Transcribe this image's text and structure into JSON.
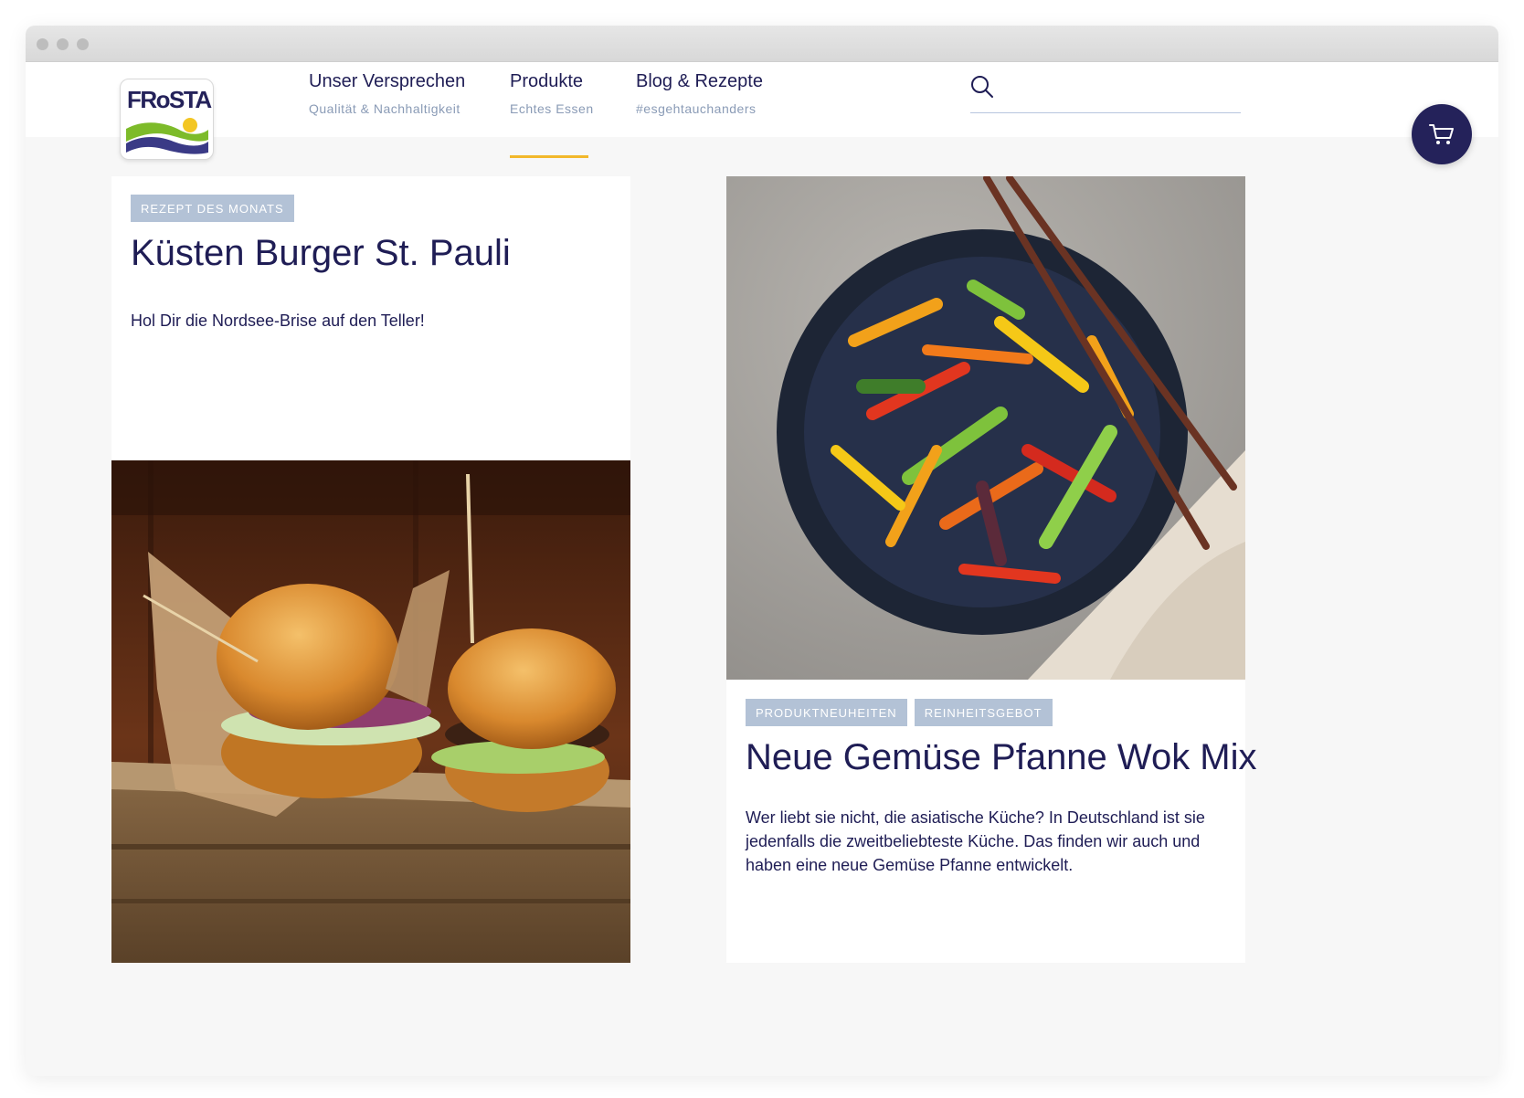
{
  "brand": {
    "logo_text": "FRoSTA"
  },
  "nav": {
    "items": [
      {
        "title": "Unser Versprechen",
        "subtitle": "Qualität & Nachhaltigkeit"
      },
      {
        "title": "Produkte",
        "subtitle": "Echtes Essen",
        "active": true
      },
      {
        "title": "Blog & Rezepte",
        "subtitle": "#esgehtauchanders"
      }
    ]
  },
  "search": {
    "value": "",
    "placeholder": ""
  },
  "cards": [
    {
      "tags": [
        "REZEPT DES MONATS"
      ],
      "title": "Küsten Burger St. Pauli",
      "description": "Hol Dir die Nordsee-Brise auf den Teller!",
      "image": "burger-photo"
    },
    {
      "tags": [
        "PRODUKTNEUHEITEN",
        "REINHEITSGEBOT"
      ],
      "title": "Neue Gemüse Pfanne Wok Mix",
      "description": "Wer liebt sie nicht, die asiatische Küche? In Deutschland ist sie jedenfalls die zweitbeliebteste Küche. Das finden wir auch und haben eine neue Gemüse Pfanne entwickelt.",
      "image": "wok-vegetables-photo"
    }
  ],
  "icons": {
    "search": "search-icon",
    "cart": "cart-icon"
  },
  "colors": {
    "brand_navy": "#1f1d55",
    "accent_yellow": "#f2b82b",
    "tag_background": "#b3c2d6",
    "subtitle": "#8a9bb6"
  }
}
